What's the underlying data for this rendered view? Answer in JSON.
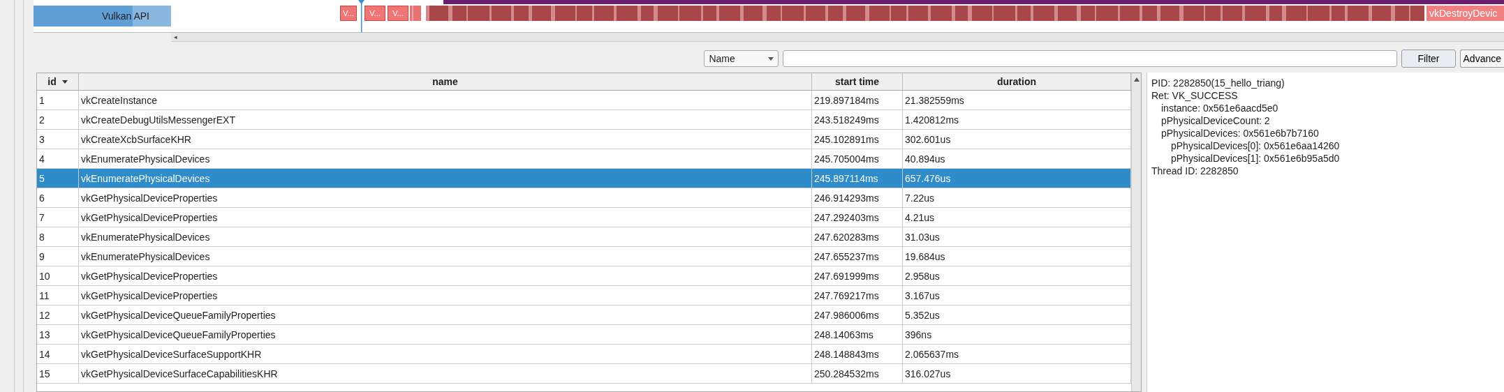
{
  "timeline": {
    "track_label": "Vulkan API",
    "events": [
      {
        "label": "V..."
      },
      {
        "label": "V..."
      },
      {
        "label": "V..."
      }
    ],
    "end_event": "vkDestroyDevic",
    "scroll_left": "◂"
  },
  "filter": {
    "field_select": "Name",
    "button": "Filter",
    "advanced_button": "Advance"
  },
  "table": {
    "columns": [
      {
        "label": "id",
        "sorted": true
      },
      {
        "label": "name",
        "sorted": false
      },
      {
        "label": "start time",
        "sorted": false
      },
      {
        "label": "duration",
        "sorted": false
      }
    ],
    "rows": [
      {
        "id": "1",
        "name": "vkCreateInstance",
        "start": "219.897184ms",
        "duration": "21.382559ms",
        "selected": false
      },
      {
        "id": "2",
        "name": "vkCreateDebugUtilsMessengerEXT",
        "start": "243.518249ms",
        "duration": "1.420812ms",
        "selected": false
      },
      {
        "id": "3",
        "name": "vkCreateXcbSurfaceKHR",
        "start": "245.102891ms",
        "duration": "302.601us",
        "selected": false
      },
      {
        "id": "4",
        "name": "vkEnumeratePhysicalDevices",
        "start": "245.705004ms",
        "duration": "40.894us",
        "selected": false
      },
      {
        "id": "5",
        "name": "vkEnumeratePhysicalDevices",
        "start": "245.897114ms",
        "duration": "657.476us",
        "selected": true
      },
      {
        "id": "6",
        "name": "vkGetPhysicalDeviceProperties",
        "start": "246.914293ms",
        "duration": "7.22us",
        "selected": false
      },
      {
        "id": "7",
        "name": "vkGetPhysicalDeviceProperties",
        "start": "247.292403ms",
        "duration": "4.21us",
        "selected": false
      },
      {
        "id": "8",
        "name": "vkEnumeratePhysicalDevices",
        "start": "247.620283ms",
        "duration": "31.03us",
        "selected": false
      },
      {
        "id": "9",
        "name": "vkEnumeratePhysicalDevices",
        "start": "247.655237ms",
        "duration": "19.684us",
        "selected": false
      },
      {
        "id": "10",
        "name": "vkGetPhysicalDeviceProperties",
        "start": "247.691999ms",
        "duration": "2.958us",
        "selected": false
      },
      {
        "id": "11",
        "name": "vkGetPhysicalDeviceProperties",
        "start": "247.769217ms",
        "duration": "3.167us",
        "selected": false
      },
      {
        "id": "12",
        "name": "vkGetPhysicalDeviceQueueFamilyProperties",
        "start": "247.986006ms",
        "duration": "5.352us",
        "selected": false
      },
      {
        "id": "13",
        "name": "vkGetPhysicalDeviceQueueFamilyProperties",
        "start": "248.14063ms",
        "duration": "396ns",
        "selected": false
      },
      {
        "id": "14",
        "name": "vkGetPhysicalDeviceSurfaceSupportKHR",
        "start": "248.148843ms",
        "duration": "2.065637ms",
        "selected": false
      },
      {
        "id": "15",
        "name": "vkGetPhysicalDeviceSurfaceCapabilitiesKHR",
        "start": "250.284532ms",
        "duration": "316.027us",
        "selected": false
      }
    ]
  },
  "details": {
    "lines": [
      {
        "text": "PID: 2282850(15_hello_triang)"
      },
      {
        "text": "Ret: VK_SUCCESS",
        "children": [
          {
            "text": "instance: 0x561e6aacd5e0"
          },
          {
            "text": "pPhysicalDeviceCount: 2"
          },
          {
            "text": "pPhysicalDevices: 0x561e6b7b7160",
            "children": [
              {
                "text": "pPhysicalDevices[0]: 0x561e6aa14260"
              },
              {
                "text": "pPhysicalDevices[1]: 0x561e6b95a5d0"
              }
            ]
          }
        ]
      },
      {
        "text": "Thread ID: 2282850"
      }
    ]
  }
}
